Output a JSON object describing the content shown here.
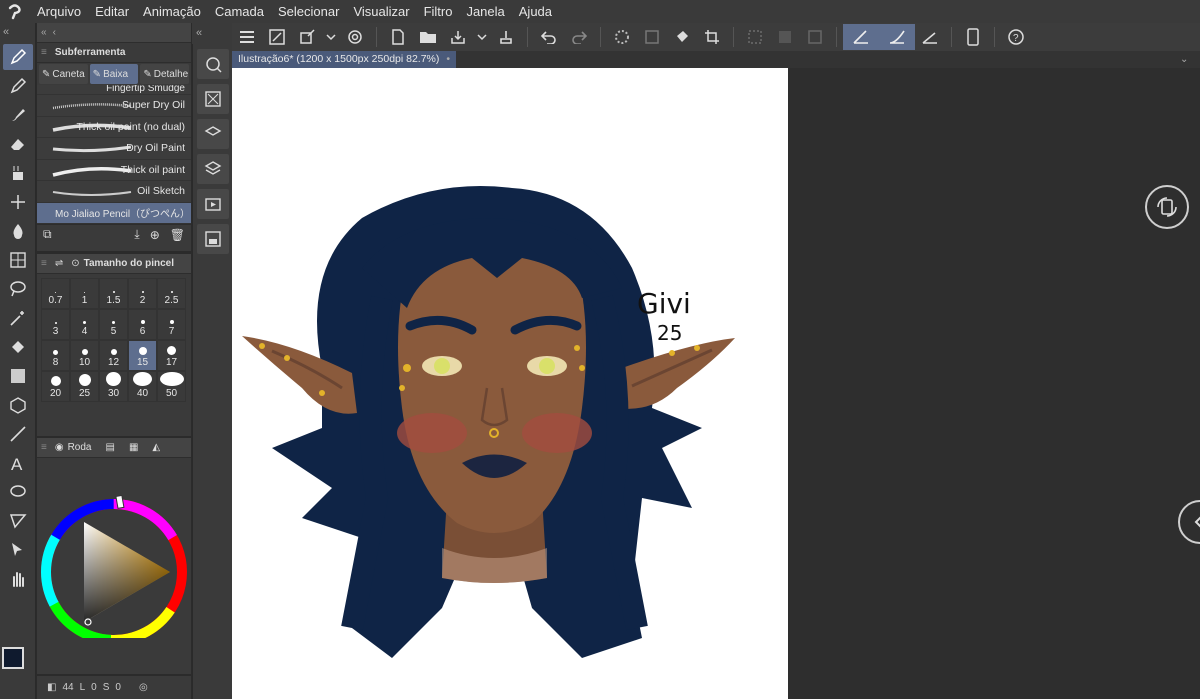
{
  "menu": {
    "items": [
      "Arquivo",
      "Editar",
      "Animação",
      "Camada",
      "Selecionar",
      "Visualizar",
      "Filtro",
      "Janela",
      "Ajuda"
    ]
  },
  "subtool": {
    "header": "Subferramenta",
    "tabs": [
      {
        "label": "Caneta",
        "icon": "pen-icon"
      },
      {
        "label": "Baixa",
        "icon": "pen-icon"
      },
      {
        "label": "Detalhe",
        "icon": "pen-icon"
      }
    ],
    "brushes": [
      "Fingertip Smudge",
      "Super Dry Oil",
      "Thick oil paint (no dual)",
      "Dry Oil Paint",
      "Thick oil paint",
      "Oil Sketch",
      "Mo Jialiao Pencil（ぴつぺん）"
    ],
    "selected_index": 6
  },
  "brushsize": {
    "header": "Tamanho do pincel",
    "sizes": [
      "0.7",
      "1",
      "1.5",
      "2",
      "2.5",
      "3",
      "4",
      "5",
      "6",
      "7",
      "8",
      "10",
      "12",
      "15",
      "17",
      "20",
      "25",
      "30",
      "40",
      "50"
    ],
    "selected": "15"
  },
  "colorpanel": {
    "tab_label": "Roda",
    "main_color": "#0f1a2e",
    "sub_color": "#ffffff"
  },
  "bottom": {
    "h_value": "44",
    "l_label": "L",
    "s_value": "0",
    "s_label": "S",
    "v_value": "0"
  },
  "document": {
    "title": "Ilustração6* (1200 x 1500px 250dpi 82.7%)",
    "modified_marker": "•"
  },
  "artwork": {
    "signature_name": "Givi",
    "signature_year": "25"
  },
  "colors": {
    "accent": "#5e6e8e",
    "hair": "#0f2446",
    "skin": "#8a5a3c",
    "skin_shadow": "#6b4532",
    "blush": "#a34c3e",
    "eye": "#d9e06a",
    "gold": "#e3b32a"
  }
}
